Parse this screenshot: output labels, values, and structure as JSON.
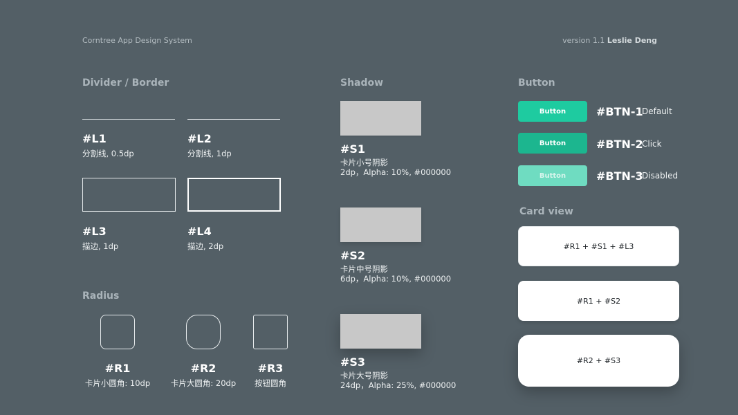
{
  "header": {
    "left": "Corntree App Design System",
    "version": "version 1.1",
    "author": "Leslie Deng"
  },
  "divider": {
    "title": "Divider / Border",
    "items": [
      {
        "code": "#L1",
        "desc": "分割线, 0.5dp"
      },
      {
        "code": "#L2",
        "desc": "分割线, 1dp"
      },
      {
        "code": "#L3",
        "desc": "描边, 1dp"
      },
      {
        "code": "#L4",
        "desc": "描边, 2dp"
      }
    ]
  },
  "radius": {
    "title": "Radius",
    "items": [
      {
        "code": "#R1",
        "desc": "卡片小圆角: 10dp"
      },
      {
        "code": "#R2",
        "desc": "卡片大圆角: 20dp"
      },
      {
        "code": "#R3",
        "desc": "按钮圆角"
      }
    ]
  },
  "shadow": {
    "title": "Shadow",
    "items": [
      {
        "code": "#S1",
        "name": "卡片小号阴影",
        "spec": "2dp，Alpha: 10%, #000000"
      },
      {
        "code": "#S2",
        "name": "卡片中号阴影",
        "spec": "6dp，Alpha: 10%, #000000"
      },
      {
        "code": "#S3",
        "name": "卡片大号阴影",
        "spec": "24dp，Alpha: 25%, #000000"
      }
    ]
  },
  "button": {
    "title": "Button",
    "items": [
      {
        "label": "Button",
        "code": "#BTN-1",
        "state": "Default",
        "color": "#1ecba0"
      },
      {
        "label": "Button",
        "code": "#BTN-2",
        "state": "Click",
        "color": "#1cb68f"
      },
      {
        "label": "Button",
        "code": "#BTN-3",
        "state": "Disabled",
        "color": "#6fdcc1"
      }
    ]
  },
  "card_view": {
    "title": "Card view",
    "items": [
      {
        "label": "#R1 + #S1 + #L3"
      },
      {
        "label": "#R1 + #S2"
      },
      {
        "label": "#R2 + #S3"
      }
    ]
  },
  "colors": {
    "background": "#535f66",
    "shadow_swatch": "#c8c8c8",
    "card": "#ffffff"
  }
}
